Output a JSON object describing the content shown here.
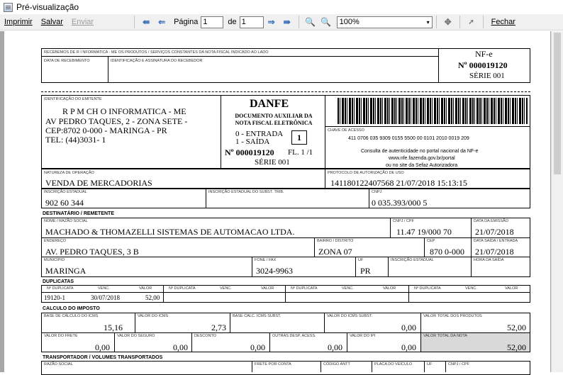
{
  "window": {
    "title": "Pré-visualização"
  },
  "toolbar": {
    "print": "Imprimir",
    "save": "Salvar",
    "send": "Enviar",
    "page_label": "Página",
    "page_value": "1",
    "of_label": "de",
    "total_pages": "1",
    "zoom": "100%",
    "close": "Fechar"
  },
  "canhoto": {
    "received_label": "RECEBEMOS DE R       I NFORMATICA - ME OS PRODUTOS / SERVIÇOS CONSTANTES DA NOTA FISCAL INDICADO AO LADO",
    "date_label": "DATA DE RECEBIMENTO",
    "sign_label": "IDENTIFICAÇÃO E ASSINATURA DO RECEBEDOR",
    "nfe": "NF-e",
    "number": "Nº 000019120",
    "serie": "SÉRIE 001"
  },
  "emitente": {
    "label": "IDENTIFICAÇÃO DO EMITENTE",
    "name": "R P M CH    O  INFORMATICA - ME",
    "address": "AV PEDRO TAQUES, 2  - ZONA SETE -",
    "city": "CEP:8702 0-000 - MARINGA - PR",
    "phone": "TEL: (44)3031-   1"
  },
  "danfe": {
    "title": "DANFE",
    "subtitle": "DOCUMENTO AUXILIAR DA NOTA FISCAL ELETRÔNICA",
    "entrada": "0 - ENTRADA",
    "saida": "1 - SAÍDA",
    "type": "1",
    "number": "Nº 000019120",
    "folha": "FL. 1 /1",
    "serie": "SÉRIE 001"
  },
  "chave": {
    "label": "CHAVE DE ACESSO",
    "value": "411  0706 035  9309 0155 5500   00 0101 2010 0019   209",
    "consulta1": "Consulta de autenticidade no portal nacional da NF-e",
    "consulta2": "www.nfe.fazenda.gov.br/portal",
    "consulta3": "ou no site da Sefaz Autorizadora"
  },
  "operacao": {
    "nat_label": "NATUREZA DE OPERAÇÃO",
    "nat_value": "VENDA DE MERCADORIAS",
    "prot_label": "PROTOCOLO DE AUTORIZAÇÃO DE USO",
    "prot_value": "141180122407568 21/07/2018 15:13:15",
    "ie_label": "INSCRIÇÃO ESTADUAL",
    "ie_value": "902  60 344",
    "iest_label": "INSCRIÇÃO ESTADUAL DO SUBST. TRIB.",
    "cnpj_label": "CNPJ",
    "cnpj_value": "0   035.393/000   5"
  },
  "destinatario": {
    "section": "DESTINATÁRIO / REMETENTE",
    "nome_label": "NOME / RAZÃO SOCIAL",
    "nome_value": "MACHADO & THOMAZELLI SISTEMAS DE AUTOMACAO LTDA.",
    "cnpj_label": "CNPJ / CPF",
    "cnpj_value": "11.47   19/000   70",
    "emissao_label": "DATA DA EMISSÃO",
    "emissao_value": "21/07/2018",
    "end_label": "ENDEREÇO",
    "end_value": "AV. PEDRO TAQUES, 3   B",
    "bairro_label": "BAIRRO / DISTRITO",
    "bairro_value": "ZONA 07",
    "cep_label": "CEP",
    "cep_value": "870   0-000",
    "saida_label": "DATA SAÍDA / ENTRADA",
    "saida_value": "21/07/2018",
    "mun_label": "MUNICÍPIO",
    "mun_value": "MARINGA",
    "fone_label": "FONE / FAX",
    "fone_value": "3024-9963",
    "uf_label": "UF",
    "uf_value": "PR",
    "ie_label": "INSCRIÇÃO ESTADUAL",
    "hora_label": "HORA DA SAÍDA"
  },
  "duplicatas": {
    "section": "DUPLICATAS",
    "h_num": "Nº DUPLICATA",
    "h_venc": "VENC.",
    "h_valor": "VALOR",
    "num": "19120-1",
    "venc": "30/07/2018",
    "valor": "52,00"
  },
  "imposto": {
    "section": "CALCULO DO IMPOSTO",
    "bc_icms_label": "BASE DE CÁLCULO DO ICMS",
    "bc_icms": "15,16",
    "icms_label": "VALOR DO ICMS",
    "icms": "2,73",
    "bc_st_label": "BASE CALC. ICMS SUBST.",
    "bc_st": "",
    "icms_st_label": "VALOR DO ICMS SUBST.",
    "icms_st": "0,00",
    "prod_label": "VALOR TOTAL DOS PRODUTOS",
    "prod": "52,00",
    "frete_label": "VALOR DO FRETE",
    "frete": "0,00",
    "seguro_label": "VALOR DO SEGURO",
    "seguro": "0,00",
    "desc_label": "DESCONTO",
    "desc": "0,00",
    "outras_label": "OUTRAS DESP. ACESS.",
    "outras": "0,00",
    "ipi_label": "VALOR DO IPI",
    "ipi": "0,00",
    "total_label": "VALOR TOTAL DA NOTA",
    "total": "52,00"
  },
  "transporte": {
    "section": "TRANSPORTADOR / VOLUMES TRANSPORTADOS",
    "razao_label": "RAZÃO SOCIAL",
    "frete_label": "FRETE POR CONTA",
    "antt_label": "CÓDIGO ANTT",
    "placa_label": "PLACA DO VEÍCULO",
    "uf_label": "UF",
    "cnpj_label": "CNPJ / CPF"
  }
}
